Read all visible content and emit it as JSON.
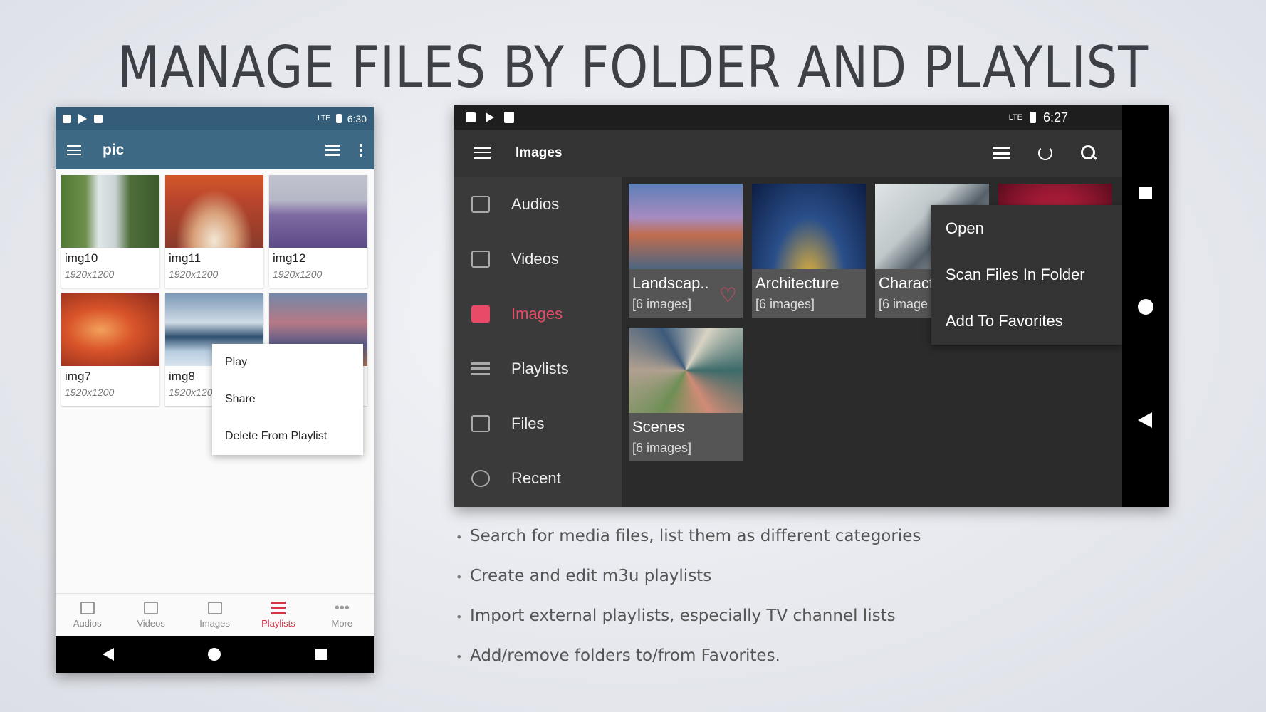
{
  "slide": {
    "title": "MANAGE FILES BY FOLDER AND PLAYLIST",
    "bullets": [
      "Search for media files, list them as different categories",
      "Create and edit m3u playlists",
      "Import external playlists, especially TV channel lists",
      "Add/remove folders to/from Favorites."
    ]
  },
  "phone": {
    "status": {
      "network": "LTE",
      "time": "6:30"
    },
    "appbar": {
      "title": "pic"
    },
    "grid": [
      {
        "name": "img10",
        "dim": "1920x1200"
      },
      {
        "name": "img11",
        "dim": "1920x1200"
      },
      {
        "name": "img12",
        "dim": "1920x1200"
      },
      {
        "name": "img7",
        "dim": "1920x1200"
      },
      {
        "name": "img8",
        "dim": "1920x1200"
      },
      {
        "name": "",
        "dim": ""
      }
    ],
    "context_menu": [
      "Play",
      "Share",
      "Delete From Playlist"
    ],
    "bottom_tabs": [
      {
        "label": "Audios",
        "icon": "audio-icon"
      },
      {
        "label": "Videos",
        "icon": "video-icon"
      },
      {
        "label": "Images",
        "icon": "image-icon"
      },
      {
        "label": "Playlists",
        "icon": "playlist-icon",
        "active": true
      },
      {
        "label": "More",
        "icon": "more-icon"
      }
    ],
    "accent_color": "#d9334a",
    "appbar_color": "#3d6985"
  },
  "tablet": {
    "status": {
      "network": "LTE",
      "time": "6:27"
    },
    "appbar": {
      "title": "Images"
    },
    "drawer": [
      {
        "label": "Audios",
        "icon": "audio-icon"
      },
      {
        "label": "Videos",
        "icon": "video-icon"
      },
      {
        "label": "Images",
        "icon": "image-icon",
        "active": true
      },
      {
        "label": "Playlists",
        "icon": "playlist-icon"
      },
      {
        "label": "Files",
        "icon": "folder-icon"
      },
      {
        "label": "Recent",
        "icon": "history-icon"
      }
    ],
    "folders": [
      {
        "name": "Landscap..",
        "count": "[6 images]",
        "favorite": true
      },
      {
        "name": "Architecture",
        "count": "[6 images]"
      },
      {
        "name": "Charact",
        "count": "[6 image"
      },
      {
        "name": "",
        "count": ""
      },
      {
        "name": "Scenes",
        "count": "[6 images]"
      }
    ],
    "context_menu": [
      "Open",
      "Scan Files In Folder",
      "Add To Favorites"
    ],
    "accent_color": "#e84b68"
  }
}
